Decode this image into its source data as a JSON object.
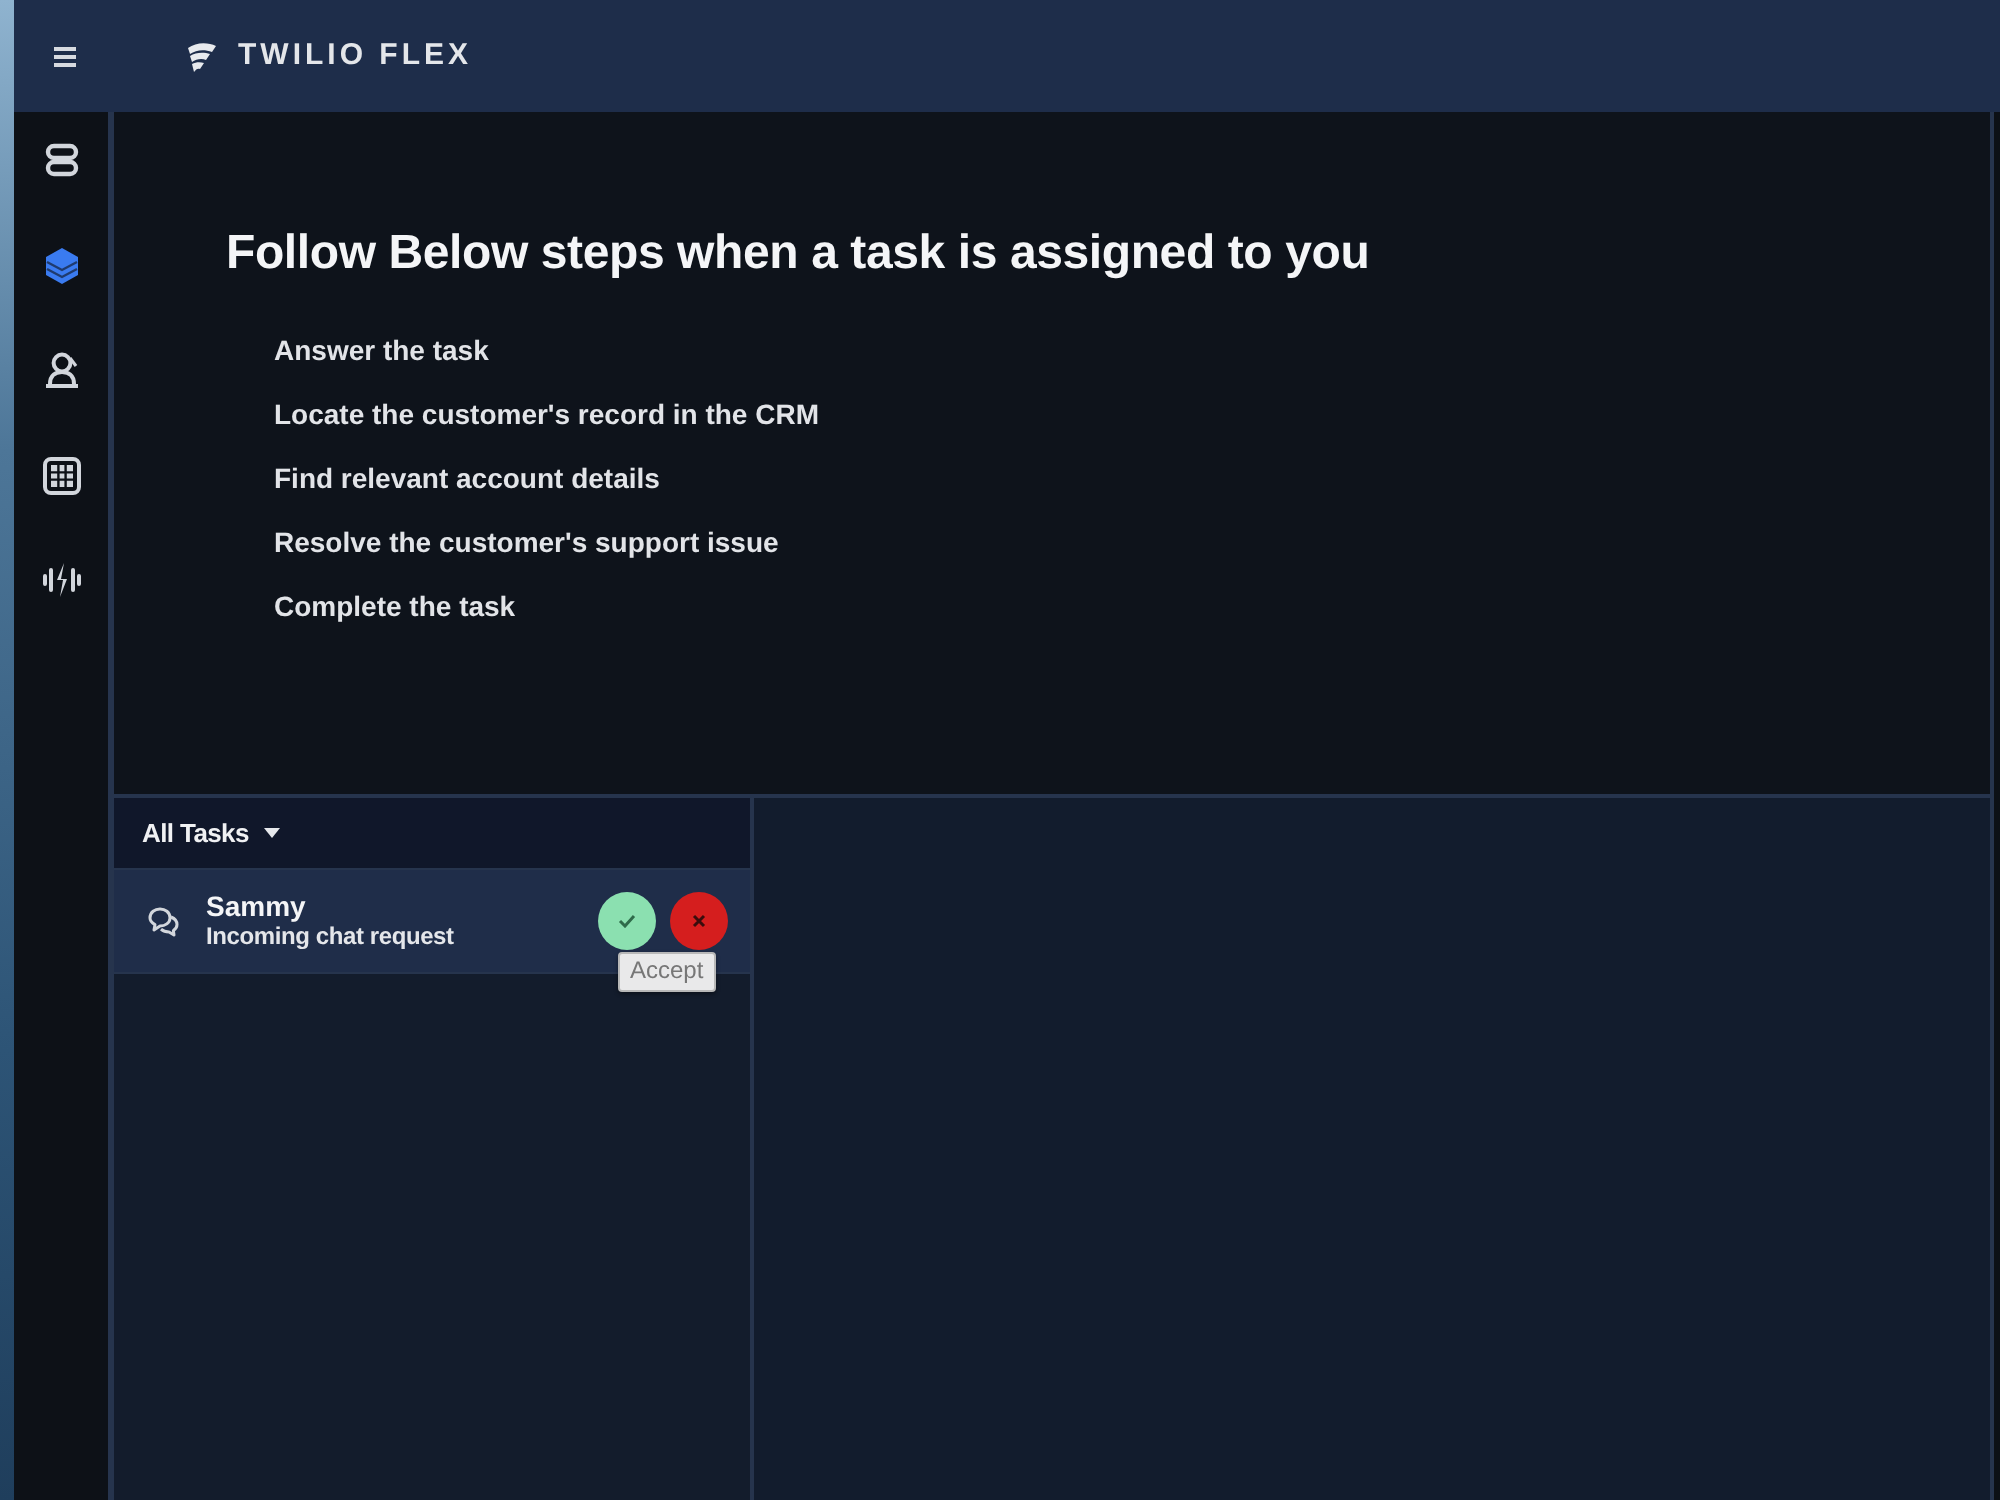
{
  "header": {
    "brand": "TWILIO FLEX"
  },
  "sidebar": {
    "items": [
      {
        "selected": false
      },
      {
        "selected": true
      },
      {
        "selected": false
      },
      {
        "selected": false
      },
      {
        "selected": false
      }
    ]
  },
  "instructions": {
    "title": "Follow Below steps when a task is assigned to you",
    "steps": [
      "Answer the task",
      "Locate the customer's record in the CRM",
      "Find relevant account details",
      "Resolve the customer's support issue",
      "Complete the task"
    ]
  },
  "task_list": {
    "filter": "All Tasks",
    "tasks": [
      {
        "name": "Sammy",
        "description": "Incoming chat request",
        "selected": true,
        "accept_tooltip": "Accept"
      }
    ]
  }
}
